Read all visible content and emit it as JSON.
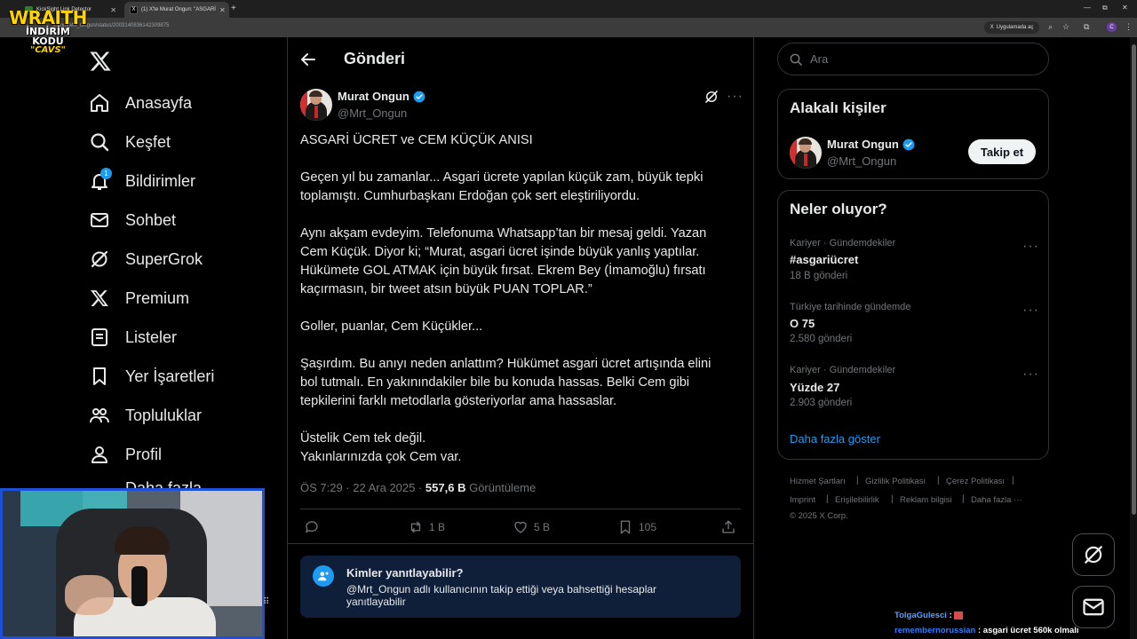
{
  "browser": {
    "tabs": [
      {
        "label": "KickSight Link Detector"
      },
      {
        "label": "(1) X'te Murat Ongun: \"ASGARİ"
      }
    ],
    "url": "x.com/Mrt_Ongun/status/2003140836142309875",
    "app_button": "Uygulamada aç"
  },
  "overlay": {
    "title": "WRAITH",
    "subtitle": "İNDİRİM KODU",
    "code": "\"CAVS\""
  },
  "nav": {
    "items": [
      {
        "label": "Anasayfa",
        "icon": "home-icon"
      },
      {
        "label": "Keşfet",
        "icon": "search-icon"
      },
      {
        "label": "Bildirimler",
        "icon": "bell-icon",
        "badge": "1"
      },
      {
        "label": "Sohbet",
        "icon": "mail-icon"
      },
      {
        "label": "SuperGrok",
        "icon": "grok-icon"
      },
      {
        "label": "Premium",
        "icon": "x-icon"
      },
      {
        "label": "Listeler",
        "icon": "list-icon"
      },
      {
        "label": "Yer İşaretleri",
        "icon": "bookmark-icon"
      },
      {
        "label": "Topluluklar",
        "icon": "communities-icon"
      },
      {
        "label": "Profil",
        "icon": "profile-icon"
      }
    ],
    "more_label": "Daha fazla"
  },
  "post": {
    "header": "Gönderi",
    "author_name": "Murat Ongun",
    "author_handle": "@Mrt_Ongun",
    "text": "ASGARİ ÜCRET ve CEM KÜÇÜK ANISI\n\nGeçen yıl bu zamanlar... Asgari ücrete yapılan küçük zam, büyük tepki toplamıştı. Cumhurbaşkanı Erdoğan çok sert eleştiriliyordu.\n\nAynı akşam evdeyim. Telefonuma Whatsapp’tan bir mesaj geldi. Yazan Cem Küçük. Diyor ki; “Murat, asgari ücret işinde büyük yanlış yaptılar. Hükümete GOL ATMAK için büyük fırsat. Ekrem Bey (İmamoğlu) fırsatı kaçırmasın, bir tweet atsın büyük PUAN TOPLAR.”\n\nGoller, puanlar, Cem Küçükler...\n\nŞaşırdım. Bu anıyı neden anlattım? Hükümet asgari ücret artışında elini bol tutmalı. En yakınındakiler bile bu konuda hassas. Belki Cem gibi tepkilerini farklı metodlarla gösteriyorlar ama hassaslar.\n\nÜstelik Cem tek değil.\nYakınlarınızda çok Cem var.",
    "time": "ÖS 7:29 · 22 Ara 2025 · ",
    "views": "557,6 B",
    "views_label": " Görüntüleme",
    "actions": {
      "reply": "",
      "repost": "1 B",
      "like": "5 B",
      "bookmark": "105"
    },
    "reply_box": {
      "title": "Kimler yanıtlayabilir?",
      "desc": "@Mrt_Ongun adlı kullanıcının takip ettiği veya bahsettiği hesaplar yanıtlayabilir"
    }
  },
  "sidebar": {
    "search_placeholder": "Ara",
    "related": {
      "title": "Alakalı kişiler",
      "name": "Murat Ongun",
      "handle": "@Mrt_Ongun",
      "follow": "Takip et"
    },
    "trends": {
      "title": "Neler oluyor?",
      "items": [
        {
          "category": "Kariyer · Gündemdekiler",
          "name": "#asgariücret",
          "count": "18 B gönderi"
        },
        {
          "category": "Türkiye tarihinde gündemde",
          "name": "O 75",
          "count": "2.580 gönderi"
        },
        {
          "category": "Kariyer · Gündemdekiler",
          "name": "Yüzde 27",
          "count": "2.903 gönderi"
        }
      ],
      "show_more": "Daha fazla göster"
    },
    "footer": {
      "links": [
        "Hizmet Şartları",
        "Gizlilik Politikası",
        "Çerez Politikası",
        "Imprint",
        "Erişilebilirlik",
        "Reklam bilgisi",
        "Daha fazla ···"
      ],
      "copyright": "© 2025 X Corp."
    }
  },
  "chat": [
    {
      "user": "TolgaGulesci",
      "message": " : "
    },
    {
      "user": "remembernorussian",
      "message": " : asgari ücret 560k olmalı"
    }
  ],
  "colors": {
    "accent": "#1d9bf0",
    "background": "#000000",
    "border": "#2f3336",
    "muted": "#71767b"
  }
}
